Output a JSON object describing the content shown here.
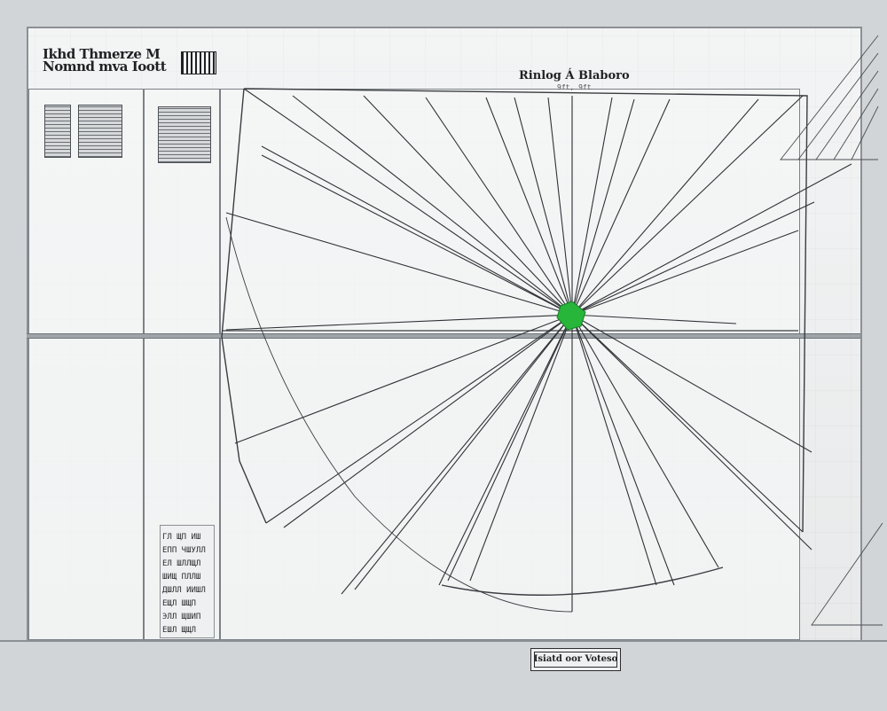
{
  "header": {
    "title": "Ikhd Thmerze M Nomnd mva Ioott",
    "barcode_icon": "barcode-icon"
  },
  "diagram": {
    "title": "Rinlog Á Blaboro",
    "subtitle": "9ft, 9ft",
    "hub_color": "#27b53a",
    "stroke_color": "#2f3236"
  },
  "legend": {
    "items": [
      "ГЛ ЩП ИШ",
      "ЕПП ЧШУЛЛ",
      "ЕЛ ШЛЛЩЛ",
      "ШИЩ ПЛЛШ",
      "ДШЛЛ ИИШЛ",
      "ЕЩЛ ШЩП",
      "ЭЛЛ ЩШИП",
      "ЕШЛ ЩЩЛ"
    ]
  },
  "stamp": {
    "label": "Isiatd oor Voteso"
  },
  "thumbnails": [
    {
      "name": "hatched-panel-small"
    },
    {
      "name": "hatched-panel-wide"
    },
    {
      "name": "hatched-panel-right"
    }
  ]
}
